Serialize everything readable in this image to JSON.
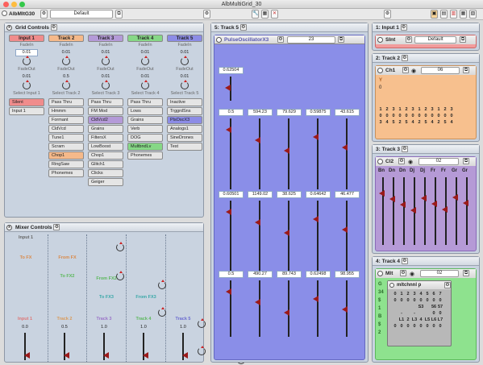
{
  "window": {
    "title": "AlbMultiGrid_30"
  },
  "toolbar": {
    "app_label": "AlbMltG30",
    "preset": "Default"
  },
  "grid_controls": {
    "title": "Grid Controls",
    "tracks": [
      {
        "name": "Input 1",
        "color": "#f08c8c",
        "fadein": "0.01",
        "fadeout": "0.01",
        "select": "Select Input 1",
        "buttons": [
          "Silent",
          "Input 1"
        ],
        "highlight": 0,
        "hcolor": "#f08c8c"
      },
      {
        "name": "Track 2",
        "color": "#f5b98a",
        "fadein": "0.01",
        "fadeout": "0.5",
        "select": "Select Track 2",
        "buttons": [
          "Pass Thru",
          "Hmmm",
          "Formant",
          "CldVcd",
          "Tune1",
          "Scram",
          "Chop1",
          "RingSaw",
          "Phonemes"
        ],
        "highlight": 6,
        "hcolor": "#f5b98a"
      },
      {
        "name": "Track 3",
        "color": "#b49ad8",
        "fadein": "0.01",
        "fadeout": "0.01",
        "select": "Select Track 3",
        "buttons": [
          "Pass Thru",
          "FM Mod",
          "CldVcd2",
          "Grains",
          "FiltersX",
          "LowBoost",
          "Chop1",
          "Glitch1",
          "Clicks",
          "Geiger"
        ],
        "highlight": 2,
        "hcolor": "#b49ad8"
      },
      {
        "name": "Track 4",
        "color": "#86d886",
        "fadein": "0.01",
        "fadeout": "0.01",
        "select": "Select Track 4",
        "buttons": [
          "Pass Thru",
          "Lows",
          "Grains",
          "Verb",
          "DOG",
          "MultbndLv",
          "Phonemes"
        ],
        "highlight": 5,
        "hcolor": "#86d886"
      },
      {
        "name": "Track 5",
        "color": "#8c8ce6",
        "fadein": "0.01",
        "fadeout": "0.01",
        "select": "Select Track 5",
        "buttons": [
          "Inactive",
          "TrggrdSns",
          "PlsOscX3",
          "Analogs1",
          "SineDrones",
          "Test"
        ],
        "highlight": 2,
        "hcolor": "#8c8ce6"
      }
    ],
    "fadein_label": "FadeIn",
    "fadeout_label": "FadeOut"
  },
  "mixer": {
    "title": "Mixer Controls",
    "input_label": "Input 1",
    "to_fx": "To FX",
    "from_fx": "From FX",
    "to_fx2": "To FX2",
    "from_fx2": "From FX2",
    "to_fx3": "To FX3",
    "from_fx3": "From FX3",
    "channels": [
      {
        "name": "Input 1",
        "value": "0.0",
        "color": "#d77"
      },
      {
        "name": "Track 2",
        "value": "0.5",
        "color": "#d99a5a"
      },
      {
        "name": "Track 3",
        "value": "1.0",
        "color": "#9a72c8"
      },
      {
        "name": "Track 4",
        "value": "1.0",
        "color": "#5bb85b"
      },
      {
        "name": "Track 5",
        "value": "1.0",
        "color": "#6a6ad0"
      }
    ]
  },
  "track5": {
    "title": "5: Track 5",
    "device": "PulseOscillatorX3",
    "preset": "23",
    "first_value": "0.62504",
    "rows": [
      [
        "0.5",
        "594.23",
        "79.629",
        "0.59875",
        "43.615"
      ],
      [
        "0.60501",
        "1149.02",
        "38.625",
        "0.64642",
        "46.477"
      ],
      [
        "0.5",
        "490.27",
        "89.743",
        "0.62498",
        "98.955"
      ]
    ]
  },
  "input1": {
    "title": "1: Input 1",
    "device": "SInt",
    "preset": "Default"
  },
  "track2": {
    "title": "2: Track 2",
    "device": "Ch1",
    "preset": "06",
    "grid": [
      [
        "1",
        "2",
        "3",
        "1",
        "2",
        "3",
        "1",
        "2",
        "3",
        "1",
        "2",
        "3"
      ],
      [
        "0",
        "0",
        "0",
        "0",
        "0",
        "0",
        "0",
        "0",
        "0",
        "0",
        "0",
        "0"
      ],
      [
        "3",
        "4",
        "5",
        "2",
        "5",
        "4",
        "2",
        "5",
        "4",
        "2",
        "5",
        "4"
      ]
    ],
    "y_label": "Y",
    "zero": "0"
  },
  "track3": {
    "title": "3: Track 3",
    "device": "Cl2",
    "preset": "02",
    "bands": [
      "Bn",
      "Dn",
      "Dn",
      "Dj",
      "Dj",
      "Fr",
      "Fr",
      "Gr",
      "Gr"
    ]
  },
  "track4": {
    "title": "4: Track 4",
    "device": "Mlt",
    "preset": "02",
    "sub": "mltchnnl p",
    "side": [
      "G",
      "34",
      "$",
      "1",
      "B",
      "$",
      "2"
    ],
    "grid": [
      [
        "0",
        "1",
        "2",
        "3",
        "4",
        "5",
        "6",
        "7"
      ],
      [
        "0",
        "0",
        "0",
        "0",
        "0",
        "0",
        "0",
        "0"
      ],
      [
        "",
        "",
        "",
        "",
        "S3",
        "",
        "56",
        "57"
      ],
      [
        "",
        "-",
        "",
        "-",
        "",
        "",
        "0",
        "0"
      ],
      [
        "",
        "L1",
        "2",
        "L3",
        "4",
        "L5",
        "L6",
        "L7"
      ],
      [
        "0",
        "0",
        "0",
        "0",
        "0",
        "0",
        "0",
        "0"
      ]
    ]
  }
}
